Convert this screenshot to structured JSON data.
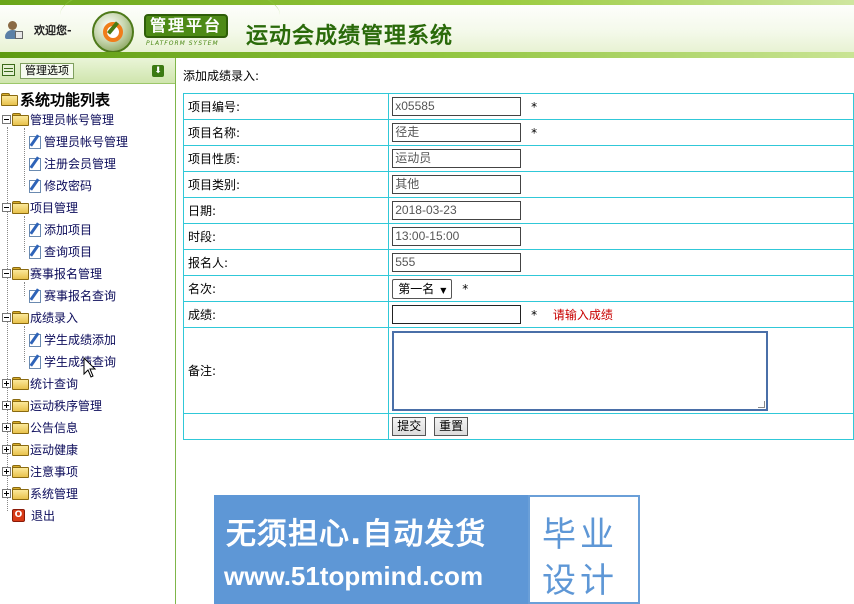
{
  "header": {
    "welcome": "欢迎您-",
    "platform_badge": "管理平台",
    "platform_sub": "PLATFORM SYSTEM",
    "title": "运动会成绩管理系统"
  },
  "sidebar": {
    "panel_label": "管理选项",
    "root_label": "系统功能列表",
    "groups": [
      {
        "label": "管理员帐号管理",
        "expanded": true,
        "items": [
          "管理员帐号管理",
          "注册会员管理",
          "修改密码"
        ]
      },
      {
        "label": "项目管理",
        "expanded": true,
        "items": [
          "添加项目",
          "查询项目"
        ]
      },
      {
        "label": "赛事报名管理",
        "expanded": true,
        "items": [
          "赛事报名查询"
        ]
      },
      {
        "label": "成绩录入",
        "expanded": true,
        "items": [
          "学生成绩添加",
          "学生成绩查询"
        ]
      },
      {
        "label": "统计查询",
        "expanded": false,
        "items": []
      },
      {
        "label": "运动秩序管理",
        "expanded": false,
        "items": []
      },
      {
        "label": "公告信息",
        "expanded": false,
        "items": []
      },
      {
        "label": "运动健康",
        "expanded": false,
        "items": []
      },
      {
        "label": "注意事项",
        "expanded": false,
        "items": []
      },
      {
        "label": "系统管理",
        "expanded": false,
        "items": []
      }
    ],
    "logout": "退出"
  },
  "main": {
    "crumb": "添加成绩录入:",
    "fields": [
      {
        "label": "项目编号:",
        "value": "x05585",
        "required": true
      },
      {
        "label": "项目名称:",
        "value": "径走",
        "required": true
      },
      {
        "label": "项目性质:",
        "value": "运动员",
        "required": false
      },
      {
        "label": "项目类别:",
        "value": "其他",
        "required": false
      },
      {
        "label": "日期:",
        "value": "2018-03-23",
        "required": false
      },
      {
        "label": "时段:",
        "value": "13:00-15:00",
        "required": false
      },
      {
        "label": "报名人:",
        "value": "555",
        "required": false
      }
    ],
    "rank": {
      "label": "名次:",
      "selected": "第一名"
    },
    "score": {
      "label": "成绩:",
      "value": "",
      "hint": "请输入成绩"
    },
    "remark": {
      "label": "备注:"
    },
    "required_mark": "*",
    "submit_label": "提交",
    "reset_label": "重置"
  },
  "watermark": {
    "line1": "无须担心.自动发货",
    "line2": "www.51topmind.com",
    "right1": "毕业",
    "right2": "设计"
  }
}
